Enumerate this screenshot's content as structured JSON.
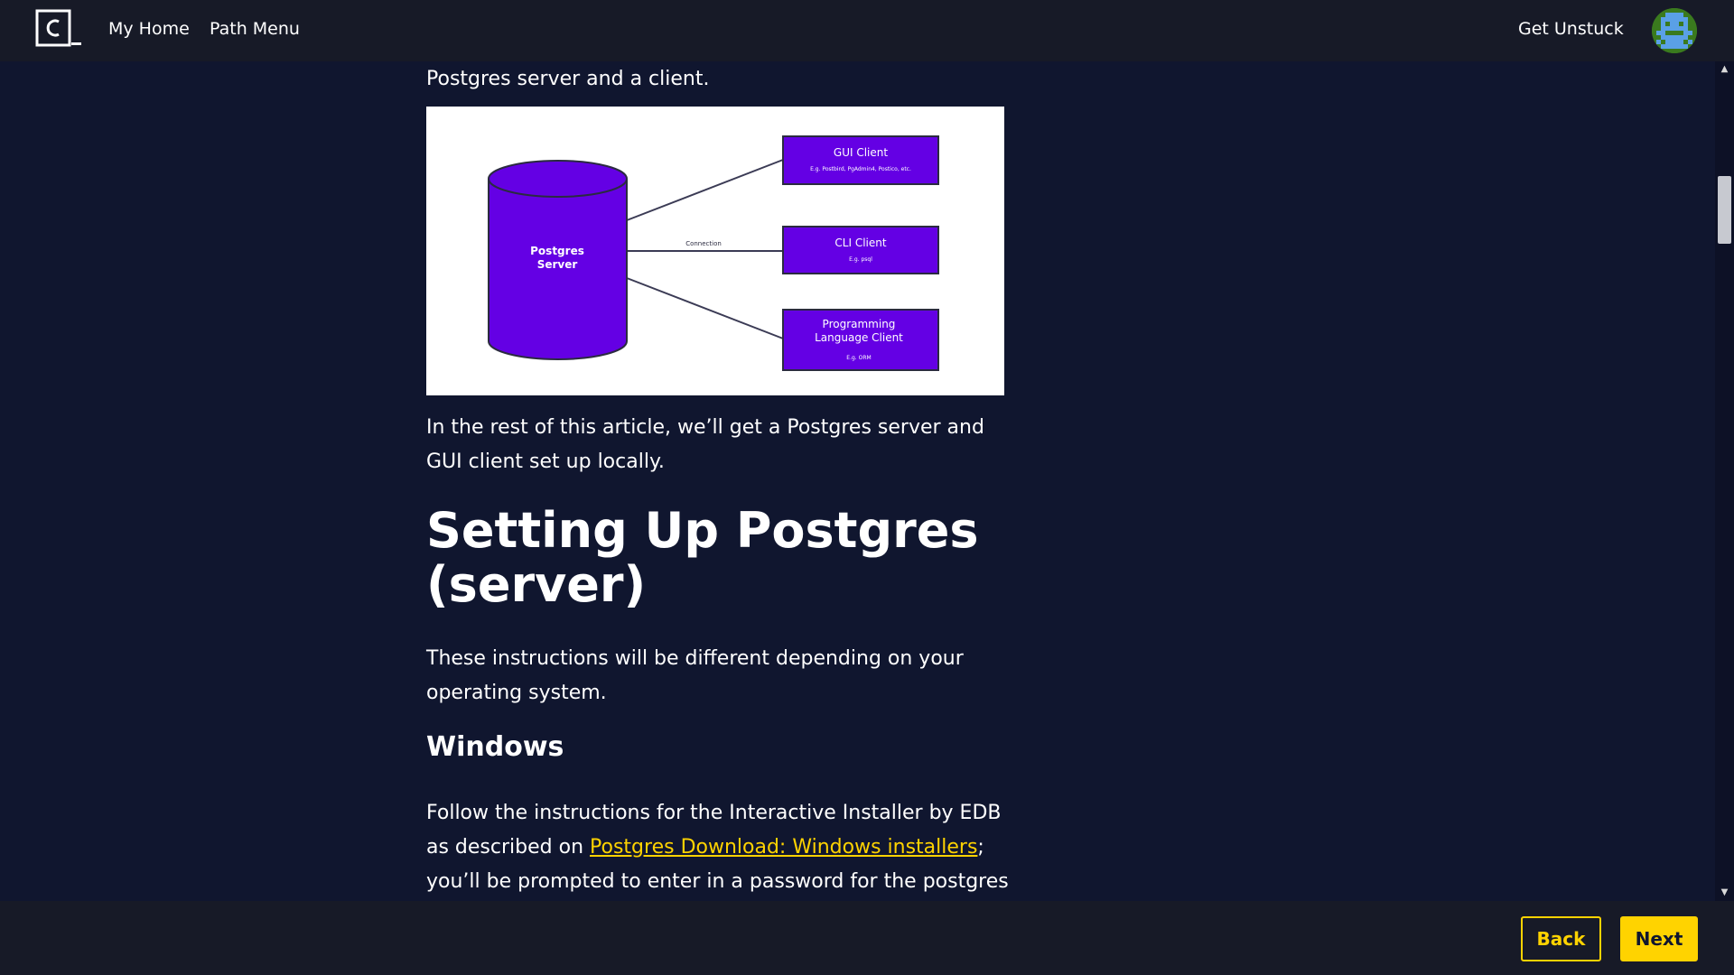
{
  "header": {
    "nav": {
      "home": "My Home",
      "path_menu": "Path Menu",
      "get_unstuck": "Get Unstuck"
    }
  },
  "article": {
    "intro_tail": "Postgres server and a client.",
    "diagram": {
      "server_label_1": "Postgres",
      "server_label_2": "Server",
      "connection_label": "Connection",
      "gui_client": "GUI Client",
      "gui_client_sub": "E.g. Postbird, PgAdmin4, Postico, etc.",
      "cli_client": "CLI Client",
      "cli_client_sub": "E.g. psql",
      "prog_client_1": "Programming",
      "prog_client_2": "Language Client",
      "prog_client_sub": "E.g. ORM"
    },
    "rest_paragraph": "In the rest of this article, we’ll get a Postgres server and GUI client set up locally.",
    "heading": "Setting Up Postgres (server)",
    "instructions": "These instructions will be different depending on your operating system.",
    "windows_heading": "Windows",
    "windows_text_before": "Follow the instructions for the Interactive Installer by EDB as described on ",
    "windows_link": "Postgres Download: Windows installers",
    "windows_text_after": "; you’ll be prompted to enter in a password for the postgres user: for now,"
  },
  "footer": {
    "back": "Back",
    "next": "Next"
  },
  "colors": {
    "background": "#10162f",
    "accent": "#ffd300",
    "diagram_purple": "#6400e4"
  }
}
